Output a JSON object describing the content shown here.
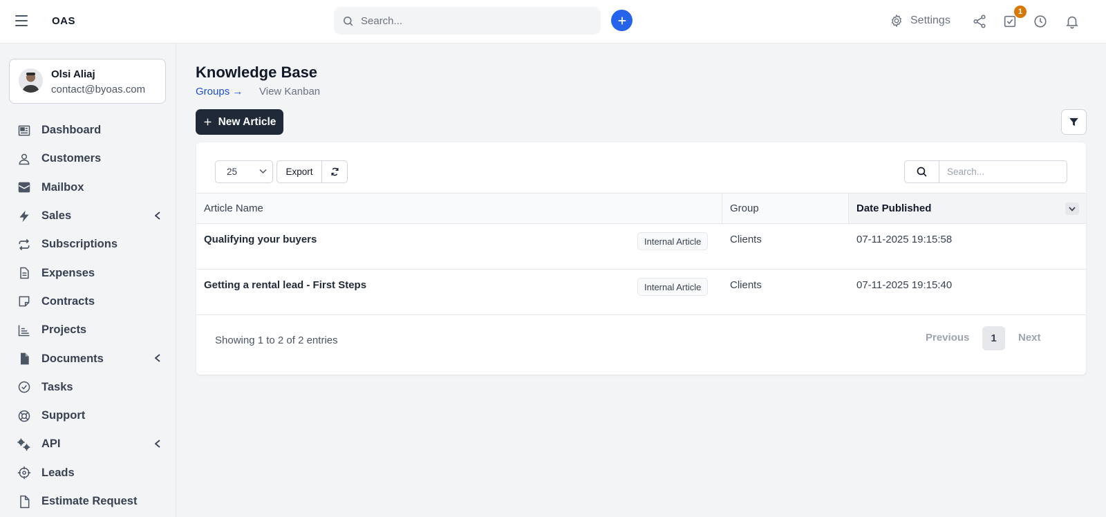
{
  "topbar": {
    "logo": "OAS",
    "search_placeholder": "Search...",
    "settings_label": "Settings",
    "tasks_badge": "1"
  },
  "user": {
    "name": "Olsi Aliaj",
    "email": "contact@byoas.com"
  },
  "sidebar": {
    "items": [
      {
        "label": "Dashboard",
        "icon": "dashboard-icon"
      },
      {
        "label": "Customers",
        "icon": "user-icon"
      },
      {
        "label": "Mailbox",
        "icon": "mail-icon"
      },
      {
        "label": "Sales",
        "icon": "bolt-icon"
      },
      {
        "label": "Subscriptions",
        "icon": "repeat-icon"
      },
      {
        "label": "Expenses",
        "icon": "file-text-icon"
      },
      {
        "label": "Contracts",
        "icon": "note-icon"
      },
      {
        "label": "Projects",
        "icon": "chart-icon"
      },
      {
        "label": "Documents",
        "icon": "document-icon"
      },
      {
        "label": "Tasks",
        "icon": "check-circle-icon"
      },
      {
        "label": "Support",
        "icon": "lifebuoy-icon"
      },
      {
        "label": "API",
        "icon": "cogs-icon"
      },
      {
        "label": "Leads",
        "icon": "crosshair-icon"
      },
      {
        "label": "Estimate Request",
        "icon": "file-icon"
      }
    ]
  },
  "page": {
    "title": "Knowledge Base",
    "breadcrumb_groups": "Groups →",
    "breadcrumb_kanban": "View Kanban",
    "new_article_label": "New Article"
  },
  "table": {
    "page_length": "25",
    "export_label": "Export",
    "search_placeholder": "Search...",
    "columns": [
      "Article Name",
      "Group",
      "Date Published"
    ],
    "rows": [
      {
        "name": "Qualifying your buyers",
        "tag": "Internal Article",
        "group": "Clients",
        "date": "07-11-2025 19:15:58"
      },
      {
        "name": "Getting a rental lead - First Steps",
        "tag": "Internal Article",
        "group": "Clients",
        "date": "07-11-2025 19:15:40"
      }
    ],
    "info": "Showing 1 to 2 of 2 entries",
    "pagination": {
      "prev": "Previous",
      "current": "1",
      "next": "Next"
    }
  },
  "colors": {
    "accent": "#2563eb",
    "dark_button": "#1f2937",
    "badge": "#d97706",
    "link": "#1d4ed8"
  }
}
